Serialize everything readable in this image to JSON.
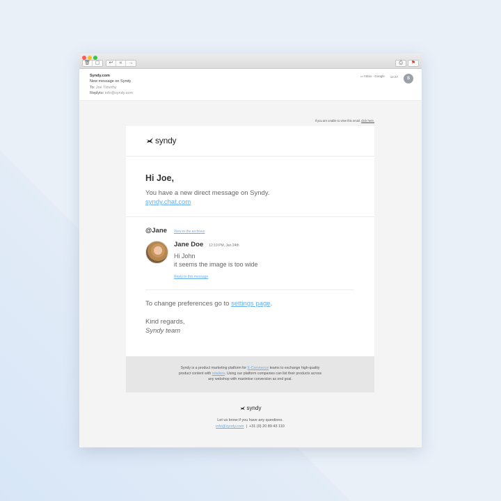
{
  "toolbar": {
    "trash_icon": "trash-icon",
    "archive_icon": "archive-icon",
    "reply_icon": "reply-icon",
    "reply_all_icon": "reply-all-icon",
    "forward_icon": "forward-icon",
    "print_icon": "print-icon",
    "flag_icon": "flag-icon"
  },
  "header": {
    "from": "Syndy.com",
    "subject": "New message on Syndy",
    "to_label": "To:",
    "to_value": "Joe Timothy",
    "reply_label": "Replyto:",
    "reply_value": "info@syndy.com",
    "mailbox": "Inbox - Google",
    "time": "12:27",
    "avatar_initial": "S"
  },
  "notice": {
    "text": "If you are unable to view this email, ",
    "link": "click here."
  },
  "email": {
    "brand": "syndy",
    "greeting": "Hi Joe,",
    "intro": "You have a new direct message on Syndy.",
    "chat_link": "syndy.chat.com",
    "handle": "@Jane",
    "archive_link": "View in the archives",
    "sender": "Jane Doe",
    "sent_time": "12:19 PM, Jan 24th",
    "message_lines": [
      "Hi John",
      "it seems the image is too wide"
    ],
    "reply_link": "Reply to this message",
    "prefs_text": "To change preferences go to ",
    "settings_link": "settings page",
    "prefs_end": ".",
    "regards": "Kind regards,",
    "team": "Syndy team"
  },
  "footer": {
    "line1_a": "Syndy is a product marketing platform for ",
    "line1_link": "E-Commerce",
    "line1_b": " teams to exchange high-quality",
    "line2_a": "product content with ",
    "line2_link": "retailers",
    "line2_b": ". Using our platform companies can list their products across",
    "line3": "any webshop with maximise conversion as end goal.",
    "brand": "syndy",
    "questions": "Let us know if you have any questions.",
    "email": "info@syndy.com",
    "separator": "|",
    "phone": "+31 (0) 20 89 43 110"
  },
  "colors": {
    "link": "#67aef0",
    "background": "#e9f0f8"
  }
}
